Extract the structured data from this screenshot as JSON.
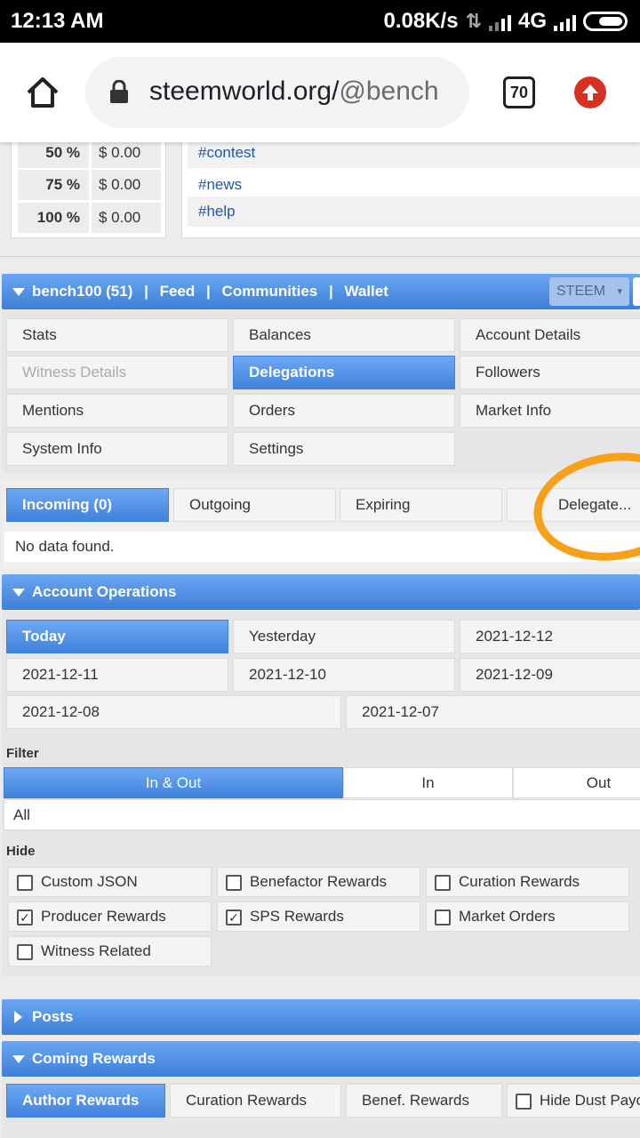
{
  "status_bar": {
    "time": "12:13 AM",
    "net_speed": "0.08K/s",
    "network": "4G"
  },
  "browser": {
    "url_main": "steemworld.org/",
    "url_rest": "@bench",
    "tab_count": "70"
  },
  "payout_table": {
    "rows": [
      {
        "pct": "50 %",
        "amount": "$ 0.00"
      },
      {
        "pct": "75 %",
        "amount": "$ 0.00"
      },
      {
        "pct": "100 %",
        "amount": "$ 0.00"
      }
    ]
  },
  "tags": [
    "#contest",
    "#news",
    "#help"
  ],
  "account_bar": {
    "account": "bench100 (51)",
    "sep": "|",
    "feed": "Feed",
    "communities": "Communities",
    "wallet": "Wallet",
    "currency": "STEEM"
  },
  "menu": {
    "items": [
      "Stats",
      "Balances",
      "Account Details",
      "Witness Details",
      "Delegations",
      "Followers",
      "Mentions",
      "Orders",
      "Market Info",
      "System Info",
      "Settings"
    ]
  },
  "delegation_tabs": {
    "incoming": "Incoming (0)",
    "outgoing": "Outgoing",
    "expiring": "Expiring",
    "delegate": "Delegate...",
    "no_data": "No data found."
  },
  "account_operations": {
    "title": "Account Operations",
    "dates": [
      "Today",
      "Yesterday",
      "2021-12-12",
      "2021-12-11",
      "2021-12-10",
      "2021-12-09",
      "2021-12-08",
      "2021-12-07"
    ],
    "filter_label": "Filter",
    "filter_options": [
      "In & Out",
      "In",
      "Out"
    ],
    "filter_value": "All",
    "hide_label": "Hide",
    "hide_options": [
      {
        "label": "Custom JSON",
        "checked": false
      },
      {
        "label": "Benefactor Rewards",
        "checked": false
      },
      {
        "label": "Curation Rewards",
        "checked": false
      },
      {
        "label": "Producer Rewards",
        "checked": true
      },
      {
        "label": "SPS Rewards",
        "checked": true
      },
      {
        "label": "Market Orders",
        "checked": false
      },
      {
        "label": "Witness Related",
        "checked": false
      }
    ],
    "check_mark": "✓"
  },
  "posts": {
    "title": "Posts"
  },
  "coming_rewards": {
    "title": "Coming Rewards",
    "tabs": [
      "Author Rewards",
      "Curation Rewards",
      "Benef. Rewards"
    ],
    "hide_dust": "Hide Dust Payo"
  },
  "colors": {
    "accent_blue": "#3f82dc",
    "highlight_circle": "#f7a11a"
  }
}
